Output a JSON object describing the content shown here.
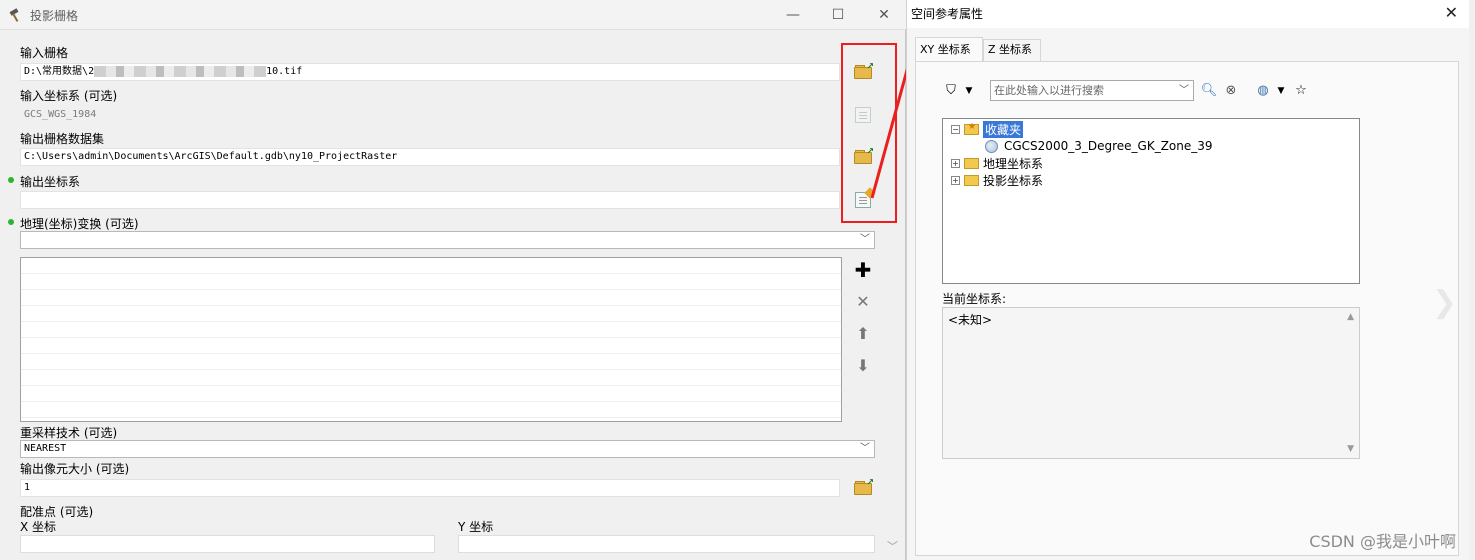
{
  "tool_window": {
    "title": "投影栅格",
    "fields": {
      "input_raster_label": "输入栅格",
      "input_raster_value_prefix": "D:\\常用数据\\2",
      "input_raster_value_suffix": "10.tif",
      "input_cs_label": "输入坐标系 (可选)",
      "input_cs_value": "GCS_WGS_1984",
      "output_raster_label": "输出栅格数据集",
      "output_raster_value": "C:\\Users\\admin\\Documents\\ArcGIS\\Default.gdb\\ny10_ProjectRaster",
      "output_cs_label": "输出坐标系",
      "output_cs_value": "",
      "geo_transform_label": "地理(坐标)变换 (可选)",
      "resampling_label": "重采样技术 (可选)",
      "resampling_value": "NEAREST",
      "cell_size_label": "输出像元大小 (可选)",
      "cell_size_value": "1",
      "registration_label": "配准点 (可选)",
      "x_label": "X 坐标",
      "y_label": "Y 坐标"
    },
    "list_buttons": [
      "add-icon",
      "remove-icon",
      "move-up-icon",
      "move-down-icon"
    ]
  },
  "sr_dialog": {
    "title": "空间参考属性",
    "tabs": [
      "XY 坐标系",
      "Z 坐标系"
    ],
    "search_placeholder": "在此处输入以进行搜索",
    "tree": {
      "favorites": "收藏夹",
      "favorite_item": "CGCS2000_3_Degree_GK_Zone_39",
      "geographic": "地理坐标系",
      "projected": "投影坐标系"
    },
    "current_cs_label": "当前坐标系:",
    "current_cs_value": "<未知>"
  },
  "watermark": "CSDN @我是小叶啊",
  "colors": {
    "highlight": "#ea2020",
    "selection": "#3a78d8",
    "required_dot": "#2db52d"
  }
}
